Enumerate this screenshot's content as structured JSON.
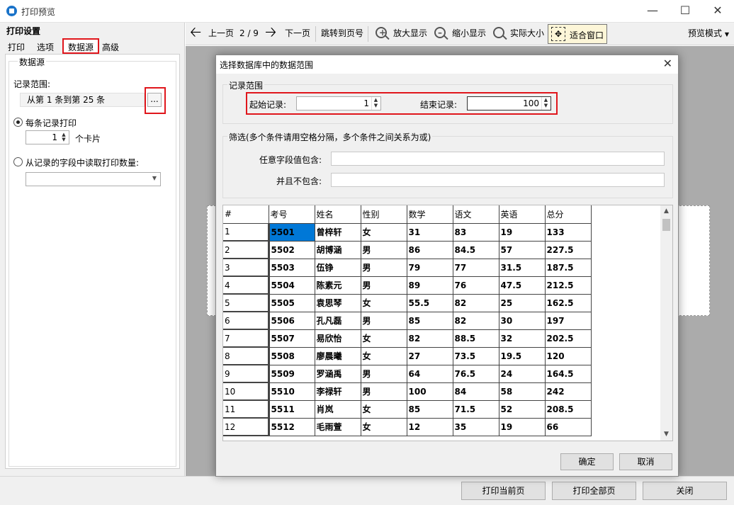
{
  "window": {
    "title": "打印预览"
  },
  "left": {
    "panel_title": "打印设置",
    "tabs": [
      "打印",
      "选项",
      "数据源",
      "高级"
    ],
    "group_label": "数据源",
    "range_label": "记录范围:",
    "range_value": "从第 1 条到第 25 条",
    "ellipsis": "...",
    "radio_each": "每条记录打印",
    "cards_value": "1",
    "cards_unit": "个卡片",
    "radio_field": "从记录的字段中读取打印数量:",
    "field_dropdown_value": ""
  },
  "toolbar": {
    "prev": "上一页",
    "page": "2 / 9",
    "next": "下一页",
    "goto": "跳转到页号",
    "zoom_in": "放大显示",
    "zoom_out": "缩小显示",
    "actual": "实际大小",
    "fit": "适合窗口",
    "mode": "预览模式"
  },
  "bottom": {
    "print_current": "打印当前页",
    "print_all": "打印全部页",
    "close": "关闭"
  },
  "dialog": {
    "title": "选择数据库中的数据范围",
    "range_group": "记录范围",
    "start_label": "起始记录:",
    "start_value": "1",
    "end_label": "结束记录:",
    "end_value": "100",
    "filter_group": "筛选(多个条件请用空格分隔，多个条件之间关系为或)",
    "contains_label": "任意字段值包含:",
    "contains_value": "",
    "not_contains_label": "并且不包含:",
    "not_contains_value": "",
    "ok": "确定",
    "cancel": "取消",
    "grid": {
      "columns": [
        "#",
        "考号",
        "姓名",
        "性别",
        "数学",
        "语文",
        "英语",
        "总分"
      ],
      "rows": [
        [
          "1",
          "5501",
          "曾梓轩",
          "女",
          "31",
          "83",
          "19",
          "133"
        ],
        [
          "2",
          "5502",
          "胡博涵",
          "男",
          "86",
          "84.5",
          "57",
          "227.5"
        ],
        [
          "3",
          "5503",
          "伍铮",
          "男",
          "79",
          "77",
          "31.5",
          "187.5"
        ],
        [
          "4",
          "5504",
          "陈素元",
          "男",
          "89",
          "76",
          "47.5",
          "212.5"
        ],
        [
          "5",
          "5505",
          "袁思琴",
          "女",
          "55.5",
          "82",
          "25",
          "162.5"
        ],
        [
          "6",
          "5506",
          "孔凡磊",
          "男",
          "85",
          "82",
          "30",
          "197"
        ],
        [
          "7",
          "5507",
          "易欣怡",
          "女",
          "82",
          "88.5",
          "32",
          "202.5"
        ],
        [
          "8",
          "5508",
          "廖晨曦",
          "女",
          "27",
          "73.5",
          "19.5",
          "120"
        ],
        [
          "9",
          "5509",
          "罗涵禹",
          "男",
          "64",
          "76.5",
          "24",
          "164.5"
        ],
        [
          "10",
          "5510",
          "李禄轩",
          "男",
          "100",
          "84",
          "58",
          "242"
        ],
        [
          "11",
          "5511",
          "肖岚",
          "女",
          "85",
          "71.5",
          "52",
          "208.5"
        ],
        [
          "12",
          "5512",
          "毛雨萱",
          "女",
          "12",
          "35",
          "19",
          "66"
        ]
      ]
    }
  }
}
